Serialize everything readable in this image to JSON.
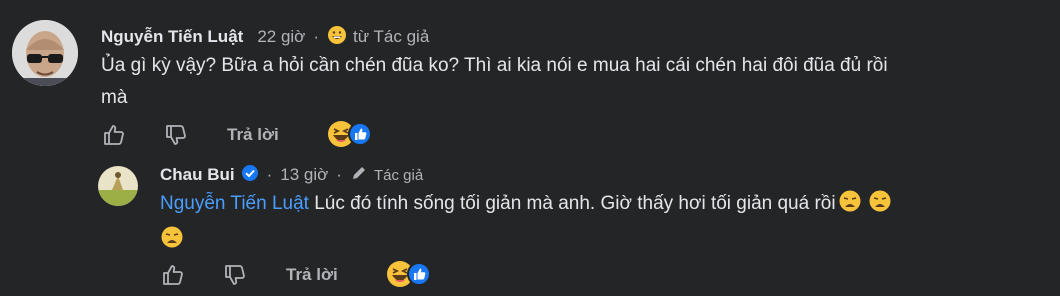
{
  "comment": {
    "author": "Nguyễn Tiến Luật",
    "time": "22 giờ",
    "from_author": "từ Tác giả",
    "text": "Ủa gì kỳ vậy? Bữa a hỏi cần chén đũa ko? Thì ai kia nói e mua hai cái chén hai đôi đũa đủ rồi",
    "text_line2": "mà",
    "reply_label": "Trả lời"
  },
  "reply": {
    "author": "Chau Bui",
    "time": "13 giờ",
    "badge": "Tác giả",
    "mention": "Nguyễn Tiến Luật",
    "text": " Lúc đó tính sống tối giản mà anh. Giờ thấy hơi tối giản quá rồi",
    "reply_label": "Trả lời"
  },
  "colors": {
    "background": "#242526",
    "mention": "#4a9eff",
    "like": "#1877f2"
  }
}
